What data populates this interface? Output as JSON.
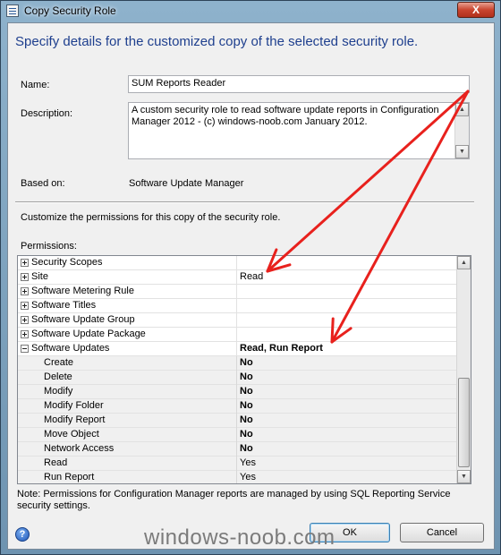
{
  "window": {
    "title": "Copy Security Role",
    "close_label": "X"
  },
  "heading": "Specify details for the customized copy of the selected security role.",
  "form": {
    "name_label": "Name:",
    "name_value": "SUM Reports Reader",
    "description_label": "Description:",
    "description_value": "A custom security role to read software update reports in Configuration Manager 2012 - (c) windows-noob.com January 2012.",
    "based_on_label": "Based on:",
    "based_on_value": "Software Update Manager"
  },
  "customize_text": "Customize the permissions for this copy of the security role.",
  "permissions_label": "Permissions:",
  "permissions": [
    {
      "name": "Security Scopes",
      "value": "",
      "expanded": false,
      "child": false
    },
    {
      "name": "Site",
      "value": "Read",
      "expanded": false,
      "child": false
    },
    {
      "name": "Software Metering Rule",
      "value": "",
      "expanded": false,
      "child": false
    },
    {
      "name": "Software Titles",
      "value": "",
      "expanded": false,
      "child": false
    },
    {
      "name": "Software Update Group",
      "value": "",
      "expanded": false,
      "child": false
    },
    {
      "name": "Software Update Package",
      "value": "",
      "expanded": false,
      "child": false
    },
    {
      "name": "Software Updates",
      "value": "Read, Run Report",
      "expanded": true,
      "child": false,
      "bold": true
    },
    {
      "name": "Create",
      "value": "No",
      "child": true,
      "bold": true
    },
    {
      "name": "Delete",
      "value": "No",
      "child": true,
      "bold": true
    },
    {
      "name": "Modify",
      "value": "No",
      "child": true,
      "bold": true
    },
    {
      "name": "Modify Folder",
      "value": "No",
      "child": true,
      "bold": true
    },
    {
      "name": "Modify Report",
      "value": "No",
      "child": true,
      "bold": true
    },
    {
      "name": "Move Object",
      "value": "No",
      "child": true,
      "bold": true
    },
    {
      "name": "Network Access",
      "value": "No",
      "child": true,
      "bold": true
    },
    {
      "name": "Read",
      "value": "Yes",
      "child": true,
      "bold": false
    },
    {
      "name": "Run Report",
      "value": "Yes",
      "child": true,
      "bold": false
    }
  ],
  "note": "Note: Permissions for Configuration Manager reports are managed by using SQL Reporting Service security settings.",
  "buttons": {
    "ok": "OK",
    "cancel": "Cancel",
    "help": "?"
  },
  "watermark": "windows-noob.com",
  "colors": {
    "heading": "#1e3f8e",
    "annotation_arrow": "#e8211d"
  },
  "icons": [
    "window-icon",
    "help-icon",
    "expand-icon",
    "collapse-icon"
  ]
}
